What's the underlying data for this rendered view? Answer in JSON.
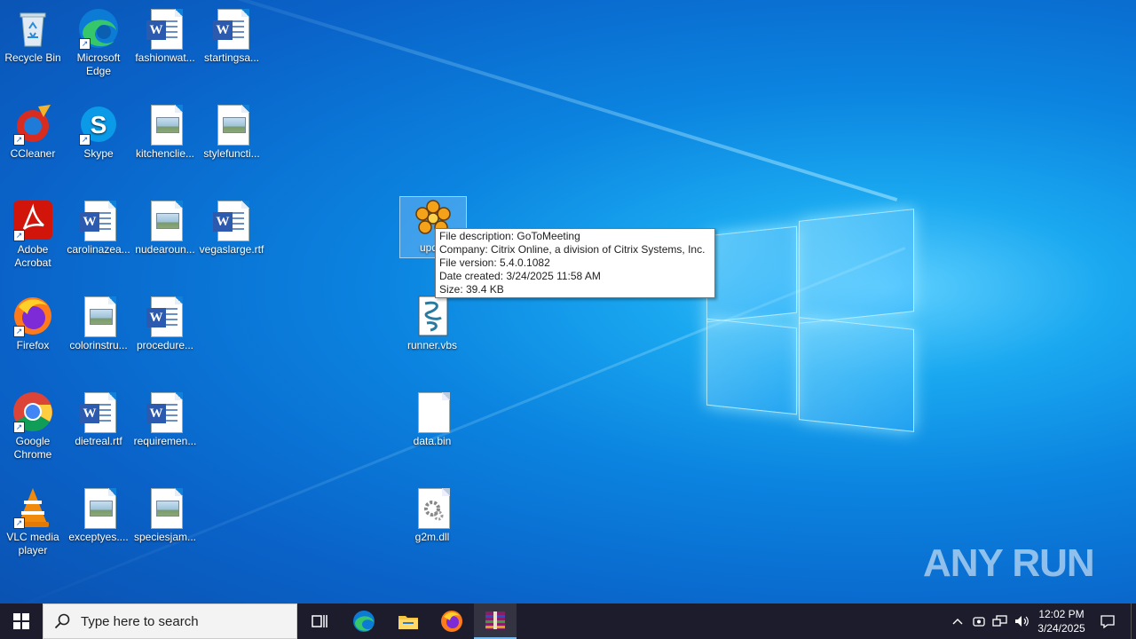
{
  "desktop": {
    "icons": [
      {
        "label": "Recycle Bin"
      },
      {
        "label": "Microsoft Edge"
      },
      {
        "label": "fashionwat..."
      },
      {
        "label": "startingsa..."
      },
      {
        "label": "CCleaner"
      },
      {
        "label": "Skype"
      },
      {
        "label": "kitchenclie..."
      },
      {
        "label": "stylefuncti..."
      },
      {
        "label": "Adobe Acrobat"
      },
      {
        "label": "carolinazea..."
      },
      {
        "label": "nudearoun..."
      },
      {
        "label": "vegaslarge.rtf"
      },
      {
        "label": "Firefox"
      },
      {
        "label": "colorinstru..."
      },
      {
        "label": "procedure..."
      },
      {
        "label": "Google Chrome"
      },
      {
        "label": "dietreal.rtf"
      },
      {
        "label": "requiremen..."
      },
      {
        "label": "VLC media player"
      },
      {
        "label": "exceptyes...."
      },
      {
        "label": "speciesjam..."
      },
      {
        "label": "updat"
      },
      {
        "label": "runner.vbs"
      },
      {
        "label": "data.bin"
      },
      {
        "label": "g2m.dll"
      }
    ]
  },
  "tooltip": {
    "description": "File description: GoToMeeting",
    "company": "Company: Citrix Online, a division of Citrix Systems, Inc.",
    "version": "File version: 5.4.0.1082",
    "created": "Date created: 3/24/2025 11:58 AM",
    "size": "Size: 39.4 KB"
  },
  "taskbar": {
    "search_placeholder": "Type here to search",
    "time": "12:02 PM",
    "date": "3/24/2025",
    "apps": [
      "task-view",
      "edge",
      "file-explorer",
      "firefox",
      "winrar"
    ]
  },
  "watermark": "ANY RUN",
  "colors": {
    "taskbar": "#1c1c2c",
    "desktop": "#0b84e0",
    "accent": "#0078d7"
  }
}
